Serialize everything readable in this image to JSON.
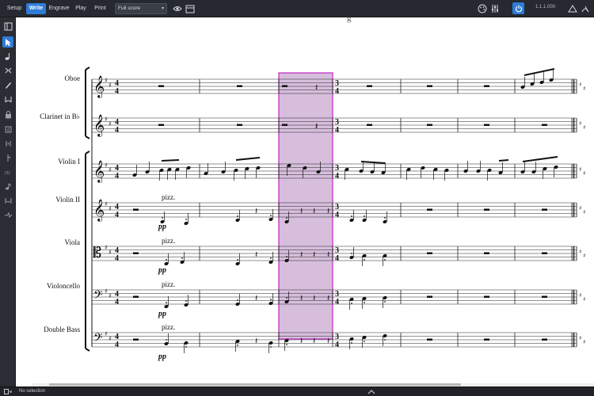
{
  "toolbar": {
    "modes": [
      {
        "label": "Setup",
        "active": false
      },
      {
        "label": "Write",
        "active": true
      },
      {
        "label": "Engrave",
        "active": false
      },
      {
        "label": "Play",
        "active": false
      },
      {
        "label": "Print",
        "active": false
      }
    ],
    "layout_select": "Full score",
    "version": "1.1.1.000"
  },
  "toolbox": {
    "tools": [
      "select-tool-icon",
      "note-input-icon",
      "insert-mode-icon",
      "pen-icon",
      "slur-tool-icon",
      "lock-icon",
      "duration-icon",
      "add-icon",
      "remove-icon",
      "rhythm-icon",
      "tie-icon",
      "dynamics-icon",
      "force-duration-icon"
    ]
  },
  "score": {
    "header_fragment": "g",
    "instruments": [
      {
        "name": "Oboe"
      },
      {
        "name": "Clarinet in B♭"
      },
      {
        "name": "Violin I"
      },
      {
        "name": "Violin II"
      },
      {
        "name": "Viola"
      },
      {
        "name": "Violoncello"
      },
      {
        "name": "Double Bass"
      }
    ],
    "time_signature_initial": "4/4",
    "time_signature_change": "3/4",
    "key_signature": "two sharps",
    "selection_color": "#d6bedc",
    "selection_border": "#c026c0",
    "annotations": {
      "violin2": {
        "technique": "pizz.",
        "dynamic": "pp"
      },
      "viola": {
        "technique": "pizz.",
        "dynamic": "pp"
      },
      "cello": {
        "technique": "pizz.",
        "dynamic": "pp"
      },
      "bass": {
        "technique": "pizz.",
        "dynamic": "pp"
      }
    }
  },
  "statusbar": {
    "text": "No selection"
  },
  "colors": {
    "accent": "#2f7bd8",
    "toolbar_bg": "#26292f",
    "selection_fill": "#d6bedc",
    "selection_stroke": "#c026c0"
  }
}
